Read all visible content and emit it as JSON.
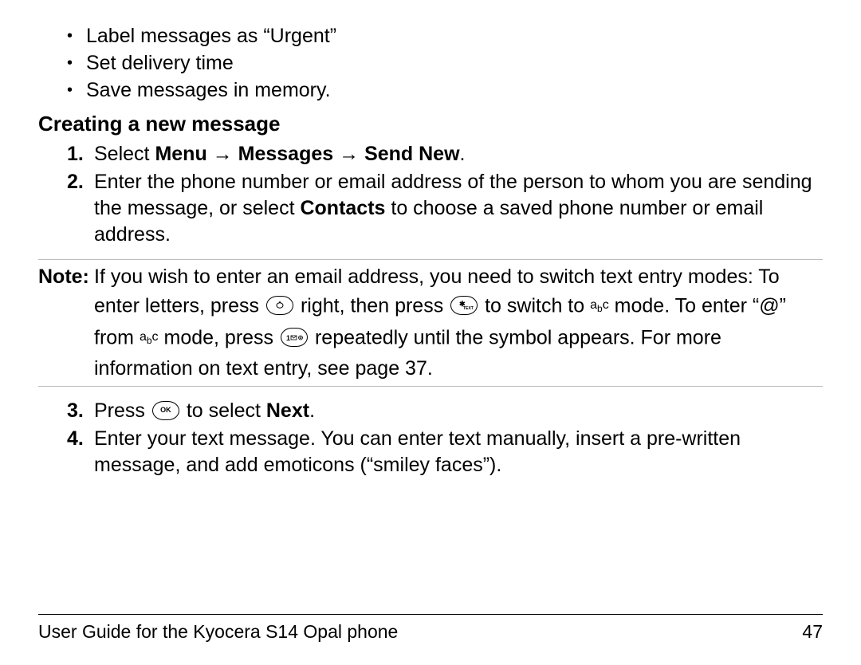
{
  "bullets": [
    "Label messages as “Urgent”",
    "Set delivery time",
    "Save messages in memory."
  ],
  "heading": "Creating a new message",
  "step1": {
    "num": "1.",
    "pre": "Select ",
    "menu": "Menu",
    "arrow1": " → ",
    "messages": "Messages",
    "arrow2": " → ",
    "sendnew": "Send New",
    "post": "."
  },
  "step2": {
    "num": "2.",
    "p1": "Enter the phone number or email address of the person to whom you are sending the message, or select ",
    "contacts": "Contacts",
    "p2": " to choose a saved phone number or email address."
  },
  "note": {
    "label": "Note:",
    "t1": "If you wish to enter an email address, you need to switch text entry modes: To enter letters, press ",
    "t2": " right, then press ",
    "t3": " to switch to ",
    "t4": " mode. To enter “@” from ",
    "t5": " mode, press ",
    "t6": " repeatedly until the symbol appears. For more information on text entry, see page 37."
  },
  "step3": {
    "num": "3.",
    "p1": "Press ",
    "p2": " to select ",
    "next": "Next",
    "p3": "."
  },
  "step4": {
    "num": "4.",
    "text": "Enter your text message. You can enter text manually, insert a pre-written message, and add emoticons (“smiley faces”)."
  },
  "footer": {
    "left": "User Guide for the Kyocera S14 Opal phone",
    "right": "47"
  },
  "icons": {
    "nav": "•",
    "star_text": "★",
    "one": "1 ✉ ◎",
    "ok": "OK"
  },
  "abc": "a",
  "abc_sub": "b",
  "abc2": "c"
}
